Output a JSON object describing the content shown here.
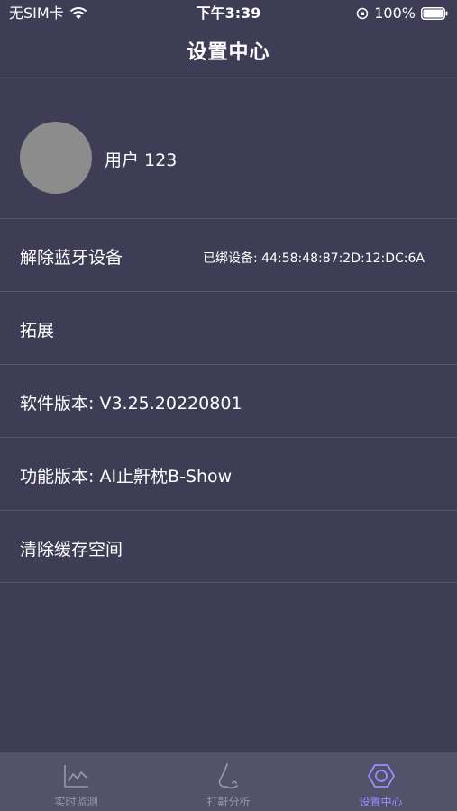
{
  "status_bar": {
    "carrier": "无SIM卡",
    "time": "下午3:39",
    "battery": "100%"
  },
  "nav": {
    "title": "设置中心"
  },
  "profile": {
    "name": "用户 123"
  },
  "rows": [
    {
      "label": "解除蓝牙设备",
      "value": "已绑设备: 44:58:48:87:2D:12:DC:6A"
    },
    {
      "label": "拓展"
    },
    {
      "label": "软件版本: V3.25.20220801"
    },
    {
      "label": "功能版本: AI止鼾枕B-Show"
    },
    {
      "label": "清除缓存空间"
    }
  ],
  "tabs": [
    {
      "label": "实时监测",
      "icon": "chart-line-icon",
      "active": false
    },
    {
      "label": "打鼾分析",
      "icon": "nose-icon",
      "active": false
    },
    {
      "label": "设置中心",
      "icon": "hexagon-settings-icon",
      "active": true
    }
  ],
  "colors": {
    "background": "#3e3d55",
    "tab_bar": "#53526b",
    "tab_active": "#a08bff",
    "tab_inactive": "#9a99ad",
    "avatar": "#8c8c8c"
  }
}
